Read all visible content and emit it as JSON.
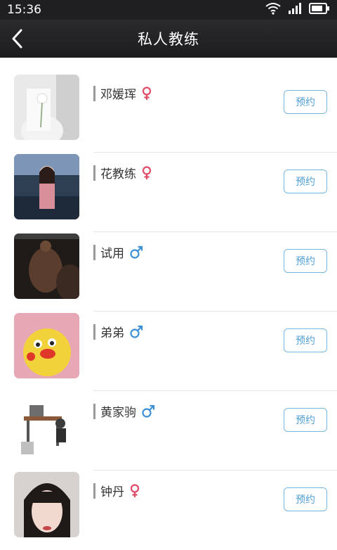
{
  "status": {
    "time": "15:36"
  },
  "header": {
    "title": "私人教练"
  },
  "coaches": [
    {
      "name": "邓媛珲",
      "gender": "female",
      "button": "预约"
    },
    {
      "name": "花教练",
      "gender": "female",
      "button": "预约"
    },
    {
      "name": "试用",
      "gender": "male",
      "button": "预约"
    },
    {
      "name": "弟弟",
      "gender": "male",
      "button": "预约"
    },
    {
      "name": "黄家驹",
      "gender": "male",
      "button": "预约"
    },
    {
      "name": "钟丹",
      "gender": "female",
      "button": "预约"
    }
  ],
  "colors": {
    "female": "#e04b66",
    "male": "#3d8fd6",
    "button_border": "#78b7e0",
    "button_text": "#4f9fd6",
    "topbar": "#1f1f22"
  },
  "icons": {
    "back": "chevron-left-icon",
    "female": "female-icon",
    "male": "male-icon",
    "wifi": "wifi-icon",
    "signal": "signal-icon",
    "battery": "battery-icon"
  }
}
